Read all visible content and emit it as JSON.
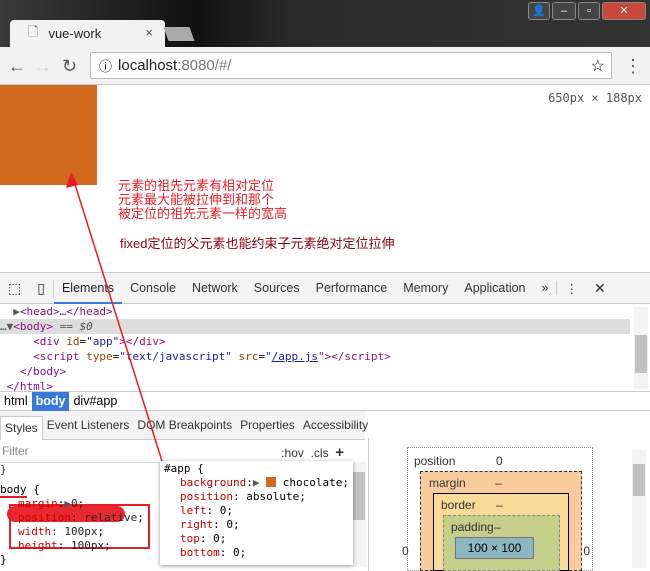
{
  "browser": {
    "tab_title": "vue-work",
    "url_host": "localhost",
    "url_rest": ":8080/#/"
  },
  "viewport": {
    "size_readout": "650px × 188px",
    "note_lines": [
      "元素的祖先元素有相对定位",
      "元素最大能被拉伸到和那个",
      "被定位的祖先元素一样的宽高"
    ],
    "note2": "fixed定位的父元素也能约束子元素绝对定位拉伸",
    "box_color": "#d2691e"
  },
  "devtools": {
    "tabs": [
      "Elements",
      "Console",
      "Network",
      "Sources",
      "Performance",
      "Memory",
      "Application"
    ],
    "more": "»",
    "tree": {
      "head": "<head>…</head>",
      "body_open": "<body>",
      "body_eq": " == $0",
      "div_open": "<div ",
      "div_attr": "id",
      "div_val": "\"app\"",
      "div_close": "></div>",
      "script_open": "<script ",
      "script_type_attr": "type",
      "script_type_val": "\"text/javascript\"",
      "script_src_attr": " src",
      "script_src_val": "/app.js",
      "script_close": "\"></script>",
      "body_close": "</body>",
      "html_close": "</html>"
    },
    "breadcrumbs": [
      "html",
      "body",
      "div#app"
    ],
    "subtabs": [
      "Styles",
      "Event Listeners",
      "DOM Breakpoints",
      "Properties",
      "Accessibility"
    ],
    "filter_placeholder": "Filter",
    "hov": ":hov",
    "cls": ".cls",
    "plus": "+",
    "body_rule": {
      "selector": "body",
      "props": [
        {
          "name": "margin",
          "value": "0"
        },
        {
          "name": "position",
          "value": "relative"
        },
        {
          "name": "width",
          "value": "100px"
        },
        {
          "name": "height",
          "value": "100px"
        }
      ]
    },
    "app_rule": {
      "selector": "#app {",
      "props": [
        {
          "name": "background",
          "value": "chocolate"
        },
        {
          "name": "position",
          "value": "absolute"
        },
        {
          "name": "left",
          "value": "0"
        },
        {
          "name": "right",
          "value": "0"
        },
        {
          "name": "top",
          "value": "0"
        },
        {
          "name": "bottom",
          "value": "0"
        }
      ]
    },
    "boxmodel": {
      "position": "position",
      "position_val": "0",
      "margin": "margin",
      "margin_val": "–",
      "border": "border",
      "border_val": "–",
      "padding": "padding",
      "padding_val": "–",
      "content": "100 × 100",
      "left": "0",
      "right": "0",
      "dash": "–"
    }
  }
}
